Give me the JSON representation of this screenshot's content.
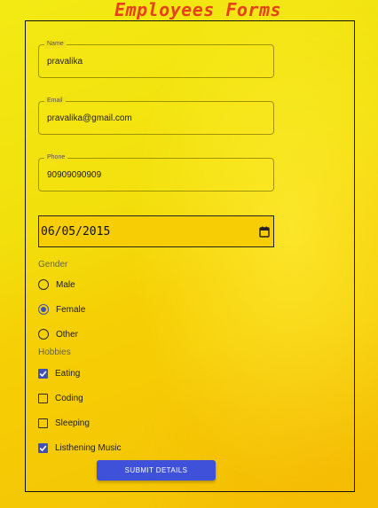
{
  "page": {
    "title": "Employees Forms"
  },
  "form": {
    "name": {
      "label": "Name",
      "value": "pravalika"
    },
    "email": {
      "label": "Email",
      "value": "pravalika@gmail.com"
    },
    "phone": {
      "label": "Phone",
      "value": "90909090909"
    },
    "date": {
      "value": "06/05/2015",
      "icon": "calendar-icon"
    },
    "gender": {
      "label": "Gender",
      "options": [
        "Male",
        "Female",
        "Other"
      ],
      "selected": "Female"
    },
    "hobbies": {
      "label": "Hobbies",
      "options": [
        "Eating",
        "Coding",
        "Sleeping",
        "Listhening Music"
      ],
      "checked": [
        "Eating",
        "Listhening Music"
      ]
    },
    "submit_label": "SUBMIT DETAILS"
  },
  "colors": {
    "accent": "#3f51d8",
    "title": "#e8401a",
    "background": "#f4d40a"
  }
}
